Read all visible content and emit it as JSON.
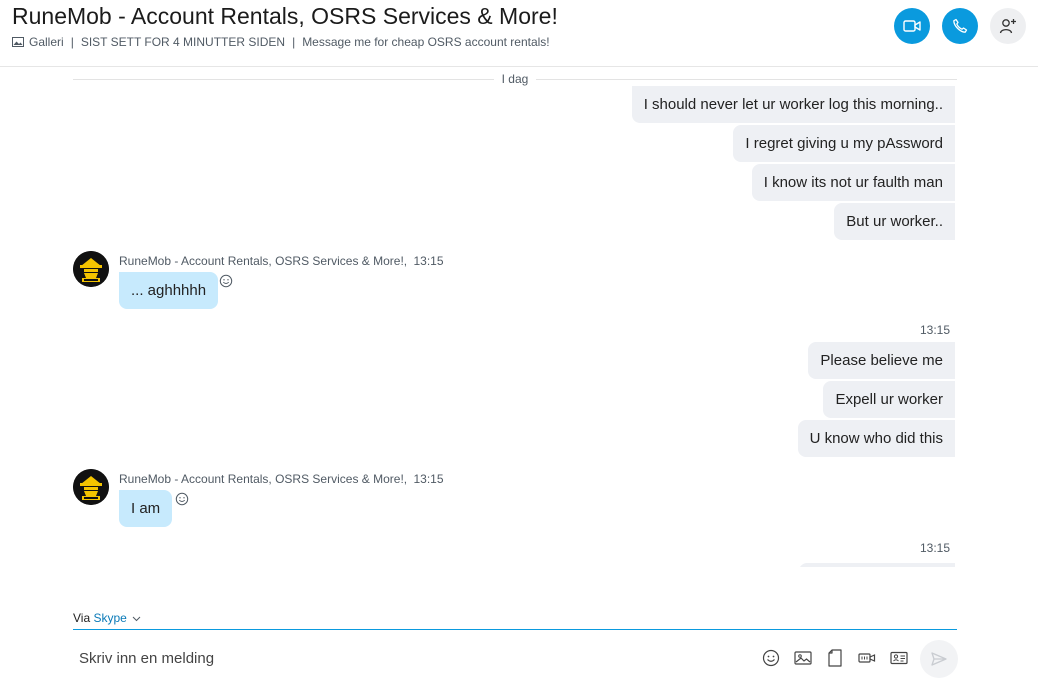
{
  "header": {
    "title": "RuneMob - Account Rentals, OSRS Services & More!",
    "gallery_label": "Galleri",
    "last_seen": "SIST SETT FOR 4 MINUTTER SIDEN",
    "mood": "Message me for cheap OSRS account rentals!",
    "video_icon": "video-camera-icon",
    "call_icon": "phone-icon",
    "add_icon": "add-person-icon"
  },
  "chat": {
    "day_label": "I dag",
    "out_group1": [
      "I should never let ur worker log this morning..",
      "I regret giving u my pAssword",
      "I know its not ur faulth man",
      "But ur worker.."
    ],
    "in1": {
      "sender": "RuneMob - Account Rentals, OSRS Services & More!,",
      "time": "13:15",
      "text": "... aghhhhh"
    },
    "out_group2_time": "13:15",
    "out_group2": [
      "Please believe me",
      "Expell ur worker",
      "U know who did this"
    ],
    "in2": {
      "sender": "RuneMob - Account Rentals, OSRS Services & More!,",
      "time": "13:15",
      "text": "I am"
    },
    "out_group3_time": "13:15"
  },
  "composer": {
    "via_label": "Via",
    "via_service": "Skype",
    "placeholder": "Skriv inn en melding"
  },
  "colors": {
    "accent": "#0a9ade",
    "incoming_bubble": "#c7eafd",
    "outgoing_bubble": "#eef0f4"
  }
}
